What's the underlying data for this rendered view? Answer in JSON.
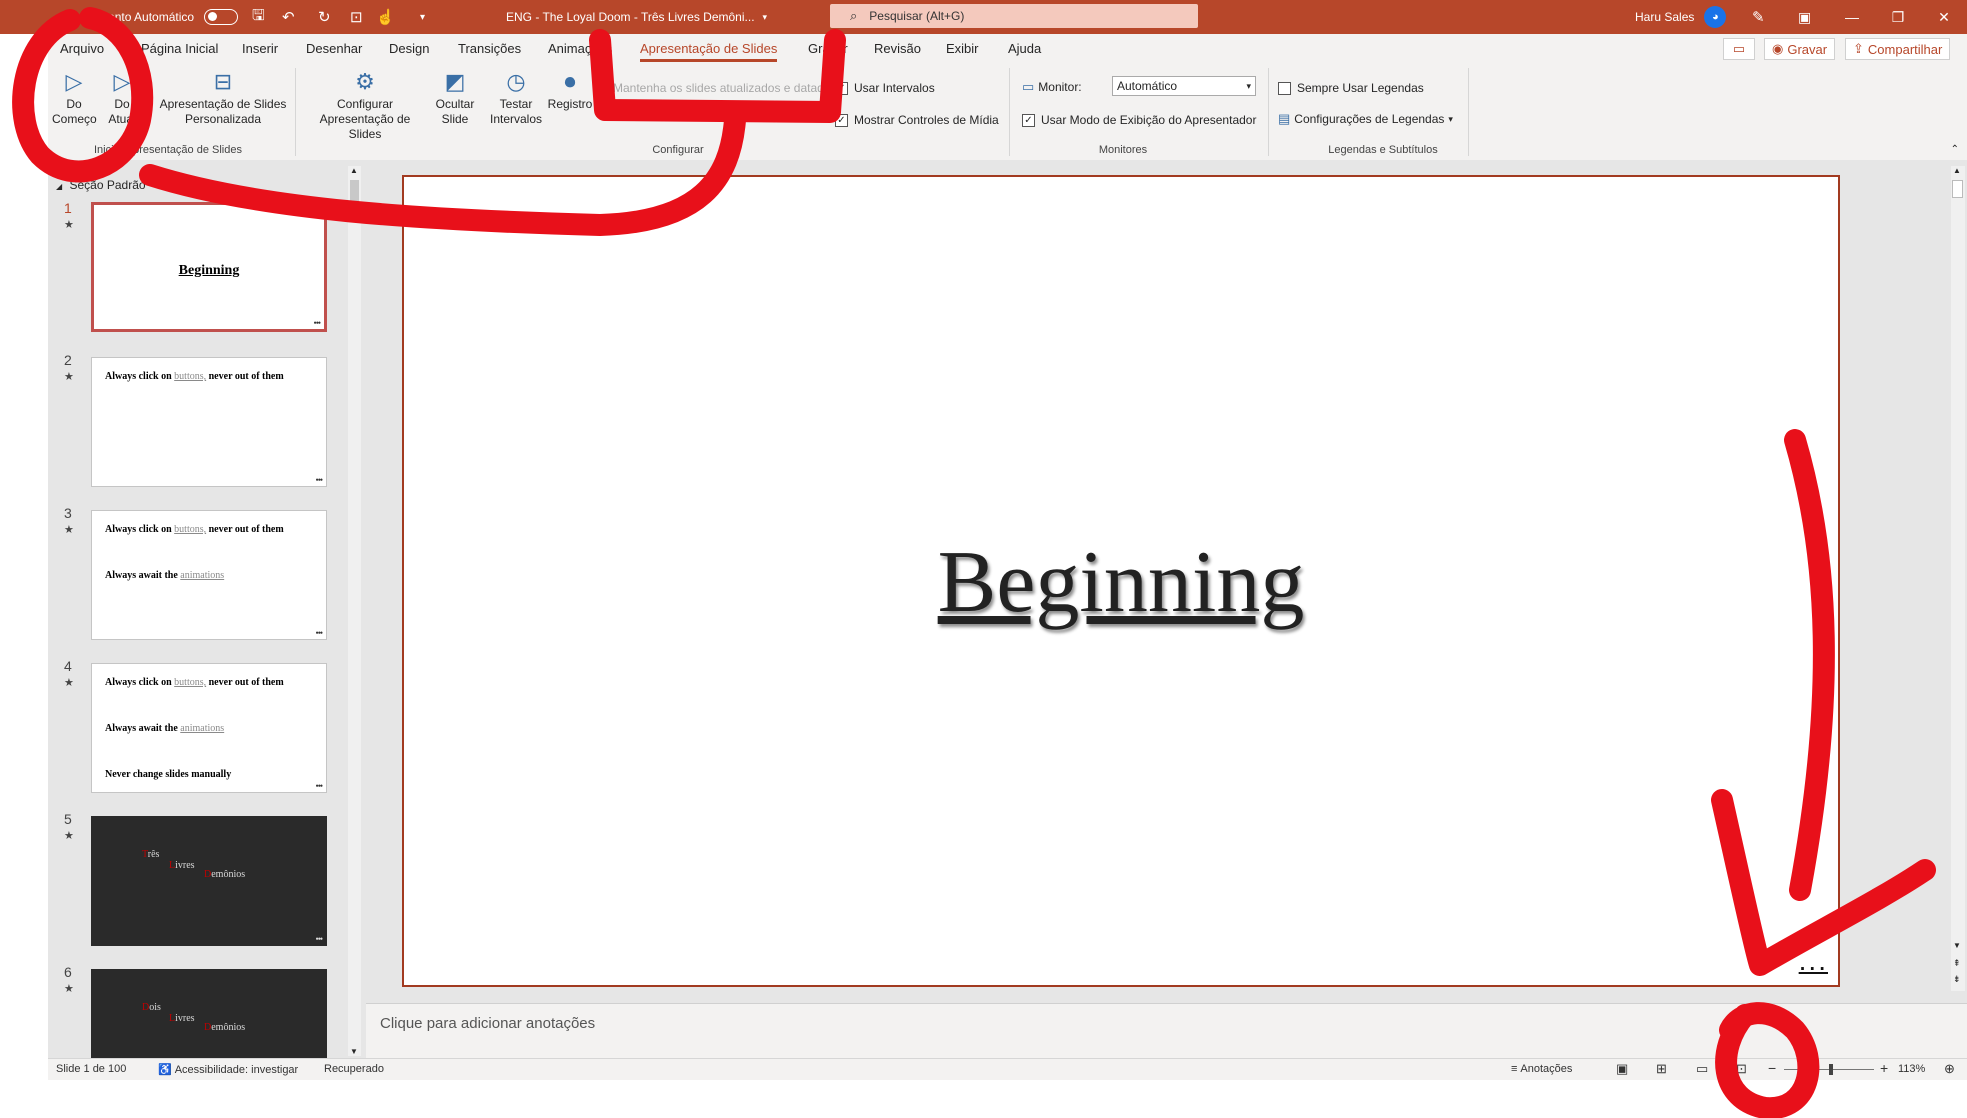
{
  "title_bar": {
    "autosave_label": "Salvamento Automático",
    "document_title": "ENG - The Loyal Doom - Três Livres Demôni...",
    "search_placeholder": "Pesquisar (Alt+G)",
    "user_name": "Haru Sales"
  },
  "ribbon_tabs": [
    "Arquivo",
    "Página Inicial",
    "Inserir",
    "Desenhar",
    "Design",
    "Transições",
    "Animações",
    "Apresentação de Slides",
    "Gravar",
    "Revisão",
    "Exibir",
    "Ajuda"
  ],
  "active_tab": "Apresentação de Slides",
  "ribbon_right": {
    "record_label": "Gravar",
    "share_label": "Compartilhar"
  },
  "ribbon": {
    "start_group": {
      "from_beginning": "Do Começo",
      "from_current": "Do Atual",
      "custom_show": "Apresentação de Slides Personalizada",
      "label": "Iniciar Apresentação de Slides"
    },
    "setup_group": {
      "setup_show": "Configurar Apresentação de Slides",
      "hide_slide": "Ocultar Slide",
      "rehearse": "Testar Intervalos",
      "record": "Registro",
      "keep_updated": "Mantenha os slides atualizados e datados",
      "use_timings": "Usar Intervalos",
      "show_media_controls": "Mostrar Controles de Mídia",
      "label": "Configurar"
    },
    "monitors_group": {
      "monitor_label": "Monitor:",
      "monitor_value": "Automático",
      "presenter_view": "Usar Modo de Exibição do Apresentador",
      "label": "Monitores"
    },
    "captions_group": {
      "always_captions": "Sempre Usar Legendas",
      "caption_settings": "Configurações de Legendas",
      "label": "Legendas e Subtítulos"
    }
  },
  "section_label": "Seção Padrão",
  "slides": {
    "s1": {
      "number": "1",
      "title": "Beginning"
    },
    "s2": {
      "number": "2",
      "line1_a": "Always click on ",
      "line1_link": "buttons,",
      "line1_b": " never out of them"
    },
    "s3": {
      "number": "3",
      "line1_a": "Always click on ",
      "line1_link": "buttons,",
      "line1_b": " never out of them",
      "line2_a": "Always await the ",
      "line2_link": "animations"
    },
    "s4": {
      "number": "4",
      "line1_a": "Always click on ",
      "line1_link": "buttons,",
      "line1_b": " never out of them",
      "line2_a": "Always await the ",
      "line2_link": "animations",
      "line3": "Never change slides manually"
    },
    "s5": {
      "number": "5",
      "w1_first": "T",
      "w1_rest": "rês",
      "w2_first": "L",
      "w2_rest": "ivres",
      "w3_first": "D",
      "w3_rest": "emônios"
    },
    "s6": {
      "number": "6",
      "w1_first": "D",
      "w1_rest": "ois",
      "w2_first": "L",
      "w2_rest": "ivres",
      "w3_first": "D",
      "w3_rest": "emônios"
    }
  },
  "main_slide": {
    "title": "Beginning",
    "corner_dots": "..."
  },
  "notes_placeholder": "Clique para adicionar anotações",
  "status_bar": {
    "slide_counter": "Slide 1 de 100",
    "accessibility": "Acessibilidade: investigar",
    "recovered": "Recuperado",
    "notes_button": "Anotações",
    "zoom": "113%"
  },
  "zoom_percent": 113,
  "colors": {
    "accent": "#b7472a",
    "annotation_red": "#e8101a"
  }
}
